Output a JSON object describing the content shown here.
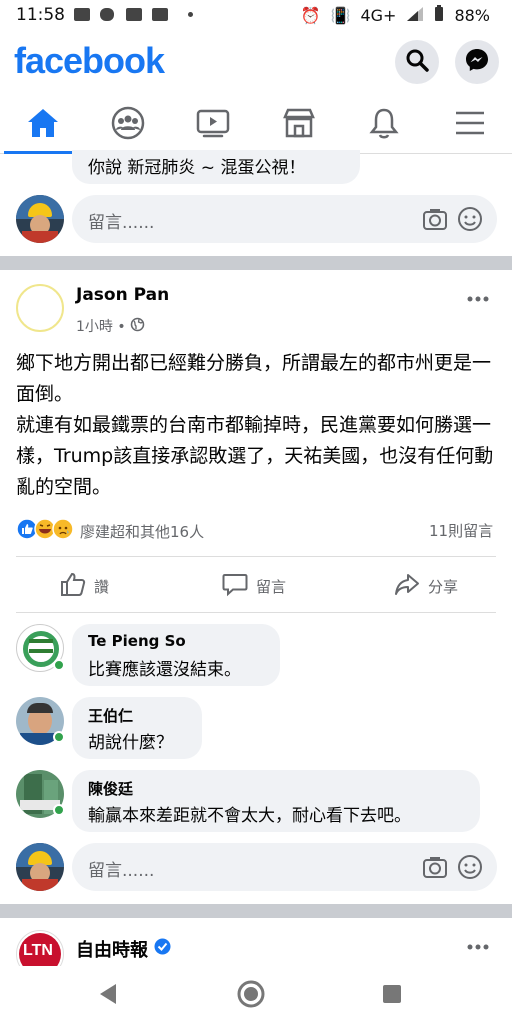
{
  "status_bar": {
    "time": "11:58",
    "network": "4G+",
    "battery": "88%"
  },
  "header": {
    "logo": "facebook"
  },
  "nav": {
    "active": "home"
  },
  "prev_post": {
    "tail_comment": "你說 新冠肺炎 ~ 混蛋公視！",
    "comment_placeholder": "留言......"
  },
  "post": {
    "author": "Jason Pan",
    "time": "1小時 •",
    "text_lines": [
      "鄉下地方開出都已經難分勝負，所謂最左的都市州更是一面倒。",
      "就連有如最鐵票的台南市都輸掉時，民進黨要如何勝選一樣，Trump該直接承認敗選了，天祐美國，也沒有任何動亂的空間。"
    ],
    "reactions_text": "廖建超和其他16人",
    "comments_count": "11則留言",
    "actions": {
      "like": "讚",
      "comment": "留言",
      "share": "分享"
    },
    "comments": [
      {
        "name": "Te Pieng So",
        "text": "比賽應該還沒結束。"
      },
      {
        "name": "王伯仁",
        "text": "胡說什麼？"
      },
      {
        "name": "陳俊廷",
        "text": "輸贏本來差距就不會太大，耐心看下去吧。"
      }
    ],
    "comment_placeholder": "留言......"
  },
  "next_post": {
    "author": "自由時報",
    "logo_text": "LTN"
  },
  "colors": {
    "brand": "#1877f2",
    "separator": "#c9ccd1",
    "bubble": "#f0f2f5",
    "online": "#31a24c"
  }
}
